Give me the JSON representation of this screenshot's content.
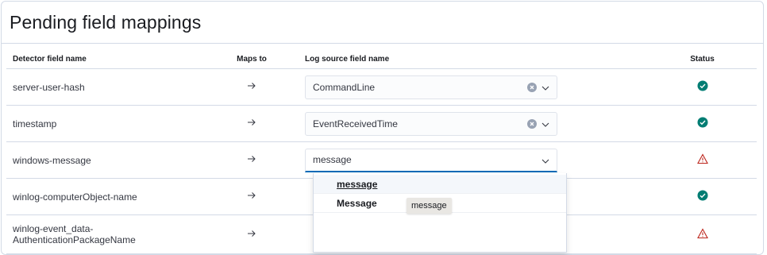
{
  "panel": {
    "title": "Pending field mappings"
  },
  "columns": {
    "detector": "Detector field name",
    "maps_to": "Maps to",
    "log_source": "Log source field name",
    "status": "Status"
  },
  "rows": [
    {
      "detector": "server-user-hash",
      "log_source": "CommandLine",
      "status": "ok"
    },
    {
      "detector": "timestamp",
      "log_source": "EventReceivedTime",
      "status": "ok"
    },
    {
      "detector": "windows-message",
      "log_source": "message",
      "status": "warning"
    },
    {
      "detector": "winlog-computerObject-name",
      "log_source": "",
      "status": "ok"
    },
    {
      "detector": "winlog-event_data-AuthenticationPackageName",
      "detector_lines": [
        "winlog-event_data-",
        "AuthenticationPackageName"
      ],
      "log_source": "",
      "status": "warning"
    }
  ],
  "dropdown": {
    "options": [
      "message",
      "Message"
    ],
    "tooltip": "message"
  },
  "colors": {
    "ok": "#017d73",
    "warning": "#bd271e",
    "accent": "#006bb8"
  },
  "icons": {
    "maps_to": "arrow-right-icon",
    "clear": "clear-icon",
    "chevron": "chevron-down-icon",
    "ok": "check-circle-icon",
    "warning": "warning-triangle-icon"
  }
}
